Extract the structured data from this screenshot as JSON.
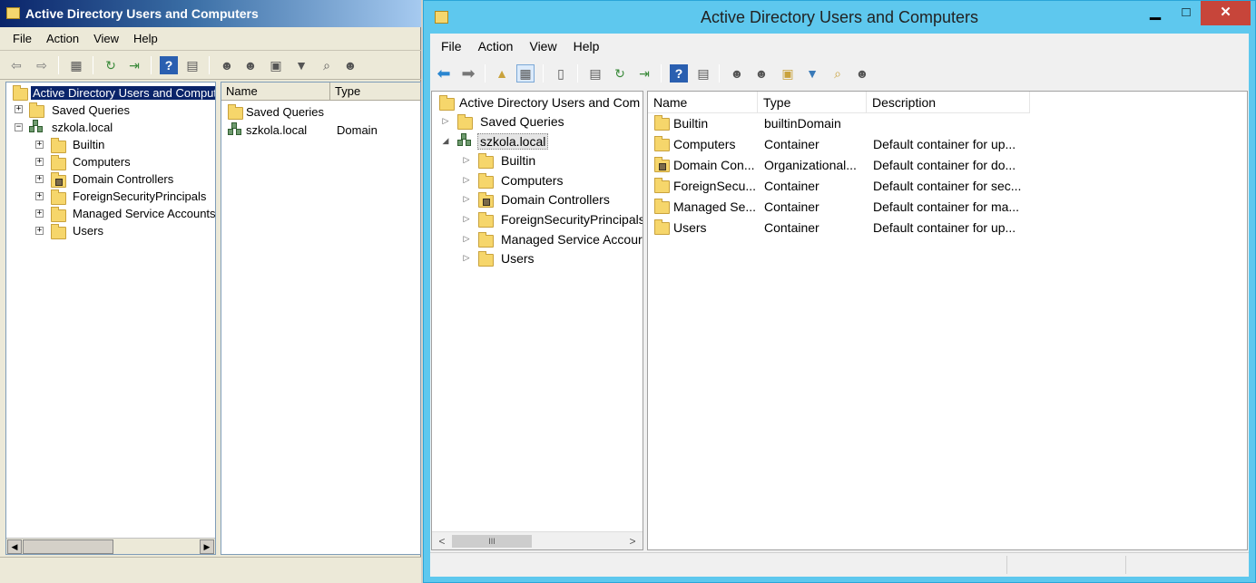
{
  "left_window": {
    "title": "Active Directory Users and Computers",
    "menu": [
      "File",
      "Action",
      "View",
      "Help"
    ],
    "tree": {
      "root": "Active Directory Users and Comput",
      "saved_queries": "Saved Queries",
      "domain": "szkola.local",
      "children": [
        "Builtin",
        "Computers",
        "Domain Controllers",
        "ForeignSecurityPrincipals",
        "Managed Service Accounts",
        "Users"
      ]
    },
    "list": {
      "columns": [
        "Name",
        "Type"
      ],
      "rows": [
        {
          "name": "Saved Queries",
          "type": ""
        },
        {
          "name": "szkola.local",
          "type": "Domain"
        }
      ]
    },
    "scroll_arrows": [
      "◀",
      "▶"
    ],
    "expander_glyphs": {
      "collapsed": "+",
      "expanded": "−"
    }
  },
  "right_window": {
    "title": "Active Directory Users and Computers",
    "window_buttons": {
      "minimize": "▁",
      "maximize": "□",
      "close": "✕"
    },
    "menu": [
      "File",
      "Action",
      "View",
      "Help"
    ],
    "tree": {
      "root": "Active Directory Users and Com",
      "saved_queries": "Saved Queries",
      "domain": "szkola.local",
      "children": [
        "Builtin",
        "Computers",
        "Domain Controllers",
        "ForeignSecurityPrincipals",
        "Managed Service Accour",
        "Users"
      ]
    },
    "list": {
      "columns": [
        "Name",
        "Type",
        "Description"
      ],
      "rows": [
        {
          "name": "Builtin",
          "type": "builtinDomain",
          "description": ""
        },
        {
          "name": "Computers",
          "type": "Container",
          "description": "Default container for up..."
        },
        {
          "name": "Domain Con...",
          "type": "Organizational...",
          "description": "Default container for do..."
        },
        {
          "name": "ForeignSecu...",
          "type": "Container",
          "description": "Default container for sec..."
        },
        {
          "name": "Managed Se...",
          "type": "Container",
          "description": "Default container for ma..."
        },
        {
          "name": "Users",
          "type": "Container",
          "description": "Default container for up..."
        }
      ]
    },
    "scroll": {
      "left": "<",
      "thumb": "III",
      "right": ">"
    },
    "tree_glyphs": {
      "collapsed": "▷",
      "expanded": "◢"
    }
  },
  "colors": {
    "classic_title": "#0a246a",
    "modern_frame": "#5ec8ee",
    "folder": "#f6d66b",
    "close_button": "#c7453a"
  }
}
